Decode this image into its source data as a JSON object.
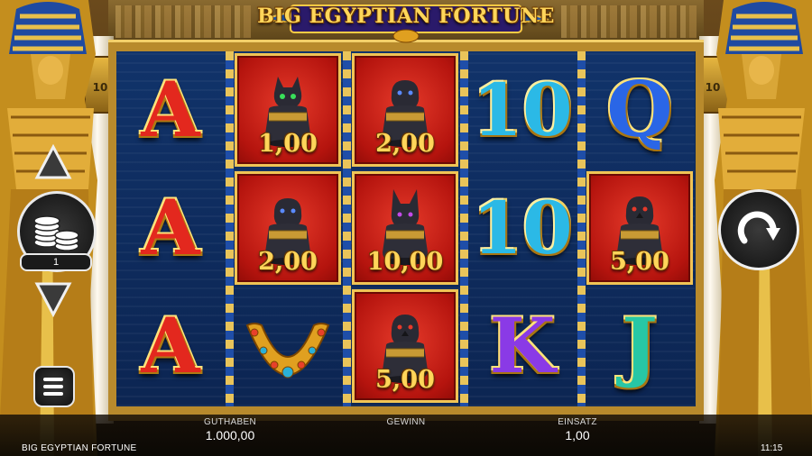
{
  "game": {
    "logo_text": "BIG EGYPTIAN FORTUNE",
    "footer_name": "BIG EGYPTIAN FORTUNE",
    "clock": "11:15"
  },
  "pillars": {
    "left_glyph": "10",
    "right_glyph": "10"
  },
  "reels": [
    [
      {
        "symbol": "A",
        "kind": "letter",
        "style": "A"
      },
      {
        "symbol": "A",
        "kind": "letter",
        "style": "A"
      },
      {
        "symbol": "A",
        "kind": "letter",
        "style": "A"
      }
    ],
    [
      {
        "symbol": "cat-canopic-jar",
        "kind": "jar",
        "value": "1,00"
      },
      {
        "symbol": "jackal-canopic-jar",
        "kind": "jar",
        "value": "2,00"
      },
      {
        "symbol": "gold-collar-necklace",
        "kind": "necklace"
      }
    ],
    [
      {
        "symbol": "jackal-canopic-jar",
        "kind": "jar",
        "value": "2,00"
      },
      {
        "symbol": "anubis-canopic-jar",
        "kind": "jar",
        "value": "10,00"
      },
      {
        "symbol": "falcon-canopic-jar",
        "kind": "jar",
        "value": "5,00"
      }
    ],
    [
      {
        "symbol": "10",
        "kind": "letter",
        "style": "ten"
      },
      {
        "symbol": "10",
        "kind": "letter",
        "style": "ten"
      },
      {
        "symbol": "K",
        "kind": "letter",
        "style": "K"
      }
    ],
    [
      {
        "symbol": "Q",
        "kind": "letter",
        "style": "Q"
      },
      {
        "symbol": "falcon-canopic-jar",
        "kind": "jar",
        "value": "5,00"
      },
      {
        "symbol": "J",
        "kind": "letter",
        "style": "J"
      }
    ]
  ],
  "controls": {
    "bet_level": "1",
    "icons": {
      "bet_up": "triangle-up-icon",
      "bet_down": "triangle-down-icon",
      "coins": "coin-stack-icon",
      "menu": "hamburger-menu-icon",
      "spin": "circular-arrow-icon"
    }
  },
  "stats": {
    "balance_label": "GUTHABEN",
    "balance_value": "1.000,00",
    "win_label": "GEWINN",
    "win_value": "",
    "bet_label": "EINSATZ",
    "bet_value": "1,00"
  },
  "colors": {
    "reel_bg": "#0d2a57",
    "red_cell": "#c8140e",
    "gold": "#f2cf6a",
    "value_text": "#ffd55a"
  }
}
